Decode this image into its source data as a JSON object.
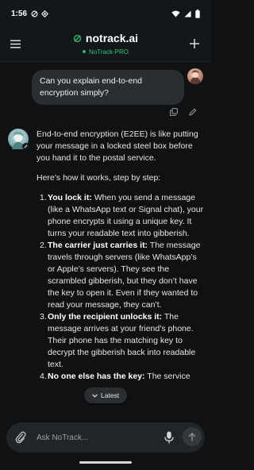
{
  "status_bar": {
    "time": "1:56",
    "left_icons": [
      "data-saver-icon",
      "vpn-diamond-icon"
    ],
    "right_icons": [
      "wifi-icon",
      "cellular-signal-icon",
      "battery-icon"
    ]
  },
  "header": {
    "title": "notrack.ai",
    "model": "NoTrack-PRO",
    "accent_color": "#2fb36d",
    "icons": {
      "menu": "hamburger-menu-icon",
      "logo": "no-track-logo-icon",
      "new_chat": "plus-icon"
    }
  },
  "user_message": {
    "text": "Can you explain end-to-end encryption simply?",
    "actions": [
      "copy-icon",
      "edit-pencil-icon"
    ]
  },
  "bot_message": {
    "intro": "End-to-end encryption (E2EE) is like putting your message in a locked steel box before you hand it to the postal service.",
    "lead": "Here’s how it works, step by step:",
    "steps": [
      {
        "num": "1.",
        "bold": "You lock it:",
        "text": " When you send a message (like a WhatsApp text or Signal chat), your phone encrypts it using a unique key. It turns your readable text into gibberish."
      },
      {
        "num": "2.",
        "bold": "The carrier just carries it:",
        "text": " The message travels through servers (like WhatsApp’s or Apple’s servers). They see the scrambled gibberish, but they don’t have the key to open it. Even if they wanted to read your message, they can’t."
      },
      {
        "num": "3.",
        "bold": "Only the recipient unlocks it:",
        "text": " The message arrives at your friend’s phone. Their phone has the matching key to decrypt the gibberish back into readable text."
      },
      {
        "num": "4.",
        "bold": "No one else has the key:",
        "text": " The service"
      }
    ]
  },
  "latest_button": {
    "label": "Latest",
    "icon": "chevron-down-icon"
  },
  "input": {
    "placeholder": "Ask NoTrack...",
    "value": "",
    "icons": {
      "attach": "paperclip-icon",
      "mic": "microphone-icon",
      "send": "arrow-up-icon"
    }
  }
}
